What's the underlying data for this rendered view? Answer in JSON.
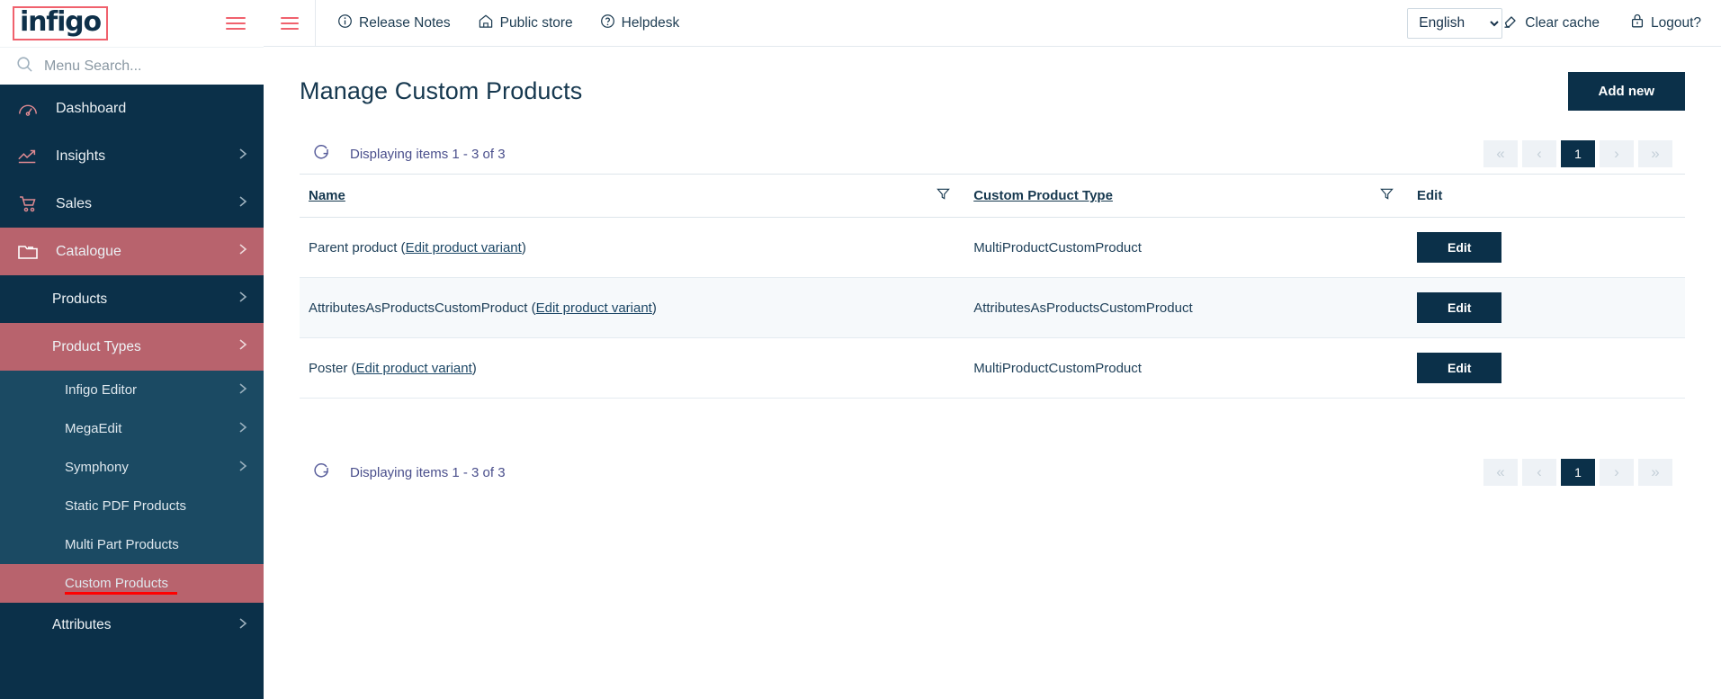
{
  "brand": {
    "logo_text": "infigo",
    "accent": "#f0616d",
    "navy": "#0b3049",
    "highlight": "#b8636d"
  },
  "sidebar": {
    "search_placeholder": "Menu Search...",
    "items": [
      {
        "label": "Dashboard",
        "icon": "dashboard-gauge-icon",
        "has_chevron": false,
        "state": "normal"
      },
      {
        "label": "Insights",
        "icon": "trend-up-icon",
        "has_chevron": true,
        "state": "normal"
      },
      {
        "label": "Sales",
        "icon": "shopping-cart-icon",
        "has_chevron": true,
        "state": "normal"
      },
      {
        "label": "Catalogue",
        "icon": "folder-icon",
        "has_chevron": true,
        "state": "active"
      }
    ],
    "sub_items": [
      {
        "label": "Products",
        "has_chevron": true,
        "state": "normal"
      },
      {
        "label": "Product Types",
        "has_chevron": true,
        "state": "active"
      }
    ],
    "sub_sub_items": [
      {
        "label": "Infigo Editor",
        "has_chevron": true,
        "state": "normal"
      },
      {
        "label": "MegaEdit",
        "has_chevron": true,
        "state": "normal"
      },
      {
        "label": "Symphony",
        "has_chevron": true,
        "state": "normal"
      },
      {
        "label": "Static PDF Products",
        "has_chevron": false,
        "state": "normal"
      },
      {
        "label": "Multi Part Products",
        "has_chevron": false,
        "state": "normal"
      },
      {
        "label": "Custom Products",
        "has_chevron": false,
        "state": "active",
        "annotated": true
      }
    ],
    "trailing_items": [
      {
        "label": "Attributes",
        "has_chevron": true,
        "state": "normal"
      }
    ]
  },
  "topbar": {
    "links": [
      {
        "label": "Release Notes",
        "icon": "info-circle-icon"
      },
      {
        "label": "Public store",
        "icon": "home-icon"
      },
      {
        "label": "Helpdesk",
        "icon": "question-circle-icon"
      }
    ],
    "language": {
      "selected": "English",
      "options": [
        "English"
      ]
    },
    "clear_cache": {
      "label": "Clear cache",
      "icon": "eraser-icon"
    },
    "logout": {
      "label": "Logout?",
      "icon": "lock-icon"
    }
  },
  "page": {
    "title": "Manage Custom Products",
    "add_new_label": "Add new"
  },
  "grid": {
    "displaying_text": "Displaying items 1 - 3 of 3",
    "refresh_icon": "refresh-icon",
    "pagination": {
      "first": "«",
      "prev": "‹",
      "pages": [
        "1"
      ],
      "current": "1",
      "next": "›",
      "last": "»"
    },
    "columns": [
      {
        "label": "Name",
        "sortable": true,
        "filterable": true
      },
      {
        "label": "Custom Product Type",
        "sortable": true,
        "filterable": true
      },
      {
        "label": "Edit",
        "sortable": false,
        "filterable": false
      }
    ],
    "rows": [
      {
        "name_prefix": "Parent product (",
        "name_link": "Edit product variant",
        "name_suffix": ")",
        "product_type": "MultiProductCustomProduct",
        "edit_label": "Edit"
      },
      {
        "name_prefix": "AttributesAsProductsCustomProduct (",
        "name_link": "Edit product variant",
        "name_suffix": ")",
        "product_type": "AttributesAsProductsCustomProduct",
        "edit_label": "Edit"
      },
      {
        "name_prefix": "Poster (",
        "name_link": "Edit product variant",
        "name_suffix": ")",
        "product_type": "MultiProductCustomProduct",
        "edit_label": "Edit"
      }
    ],
    "bottom_displaying_text": "Displaying items 1 - 3 of 3"
  }
}
